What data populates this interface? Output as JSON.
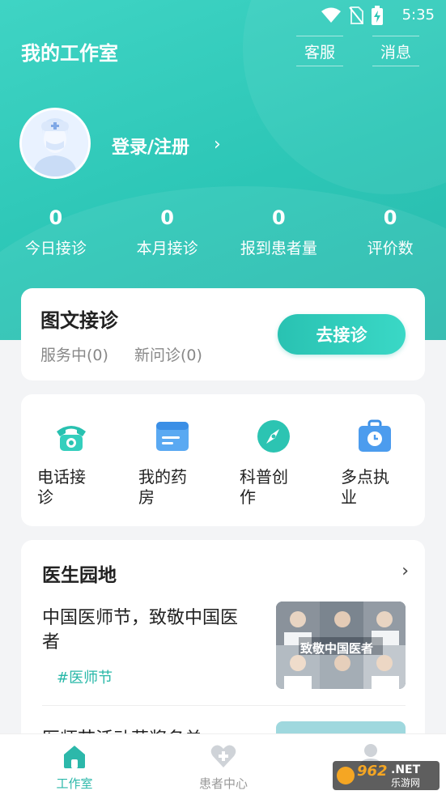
{
  "status": {
    "time": "5:35",
    "icons": [
      "wifi-icon",
      "no-sim-icon",
      "battery-charging-icon"
    ]
  },
  "header": {
    "title": "我的工作室",
    "service_label": "客服",
    "message_label": "消息"
  },
  "profile": {
    "avatar_icon": "doctor-avatar-icon",
    "login_label": "登录/注册"
  },
  "stats": [
    {
      "value": "0",
      "label": "今日接诊"
    },
    {
      "value": "0",
      "label": "本月接诊"
    },
    {
      "value": "0",
      "label": "报到患者量"
    },
    {
      "value": "0",
      "label": "评价数"
    }
  ],
  "consult": {
    "title": "图文接诊",
    "in_service": "服务中(0)",
    "new_inquiry": "新问诊(0)",
    "button_label": "去接诊"
  },
  "services": [
    {
      "label": "电话接诊",
      "icon": "telephone-icon"
    },
    {
      "label": "我的药房",
      "icon": "pharmacy-card-icon"
    },
    {
      "label": "科普创作",
      "icon": "compass-icon"
    },
    {
      "label": "多点执业",
      "icon": "briefcase-clock-icon"
    }
  ],
  "garden": {
    "title": "医生园地",
    "articles": [
      {
        "title": "中国医师节，致敬中国医者",
        "tag": "#医师节",
        "thumb_text": "致敬中国医者"
      },
      {
        "title": "医师节活动获奖名单"
      }
    ]
  },
  "tabs": [
    {
      "label": "工作室",
      "icon": "home-icon",
      "active": true
    },
    {
      "label": "患者中心",
      "icon": "heart-plus-icon",
      "active": false
    },
    {
      "label": "",
      "icon": "person-icon",
      "active": false
    }
  ],
  "watermark": {
    "number": "962",
    "suffix": ".NET",
    "text": "乐游网"
  },
  "colors": {
    "primary": "#2cc6b6",
    "accent_text": "#28b8a8",
    "background": "#f3f4f6"
  }
}
